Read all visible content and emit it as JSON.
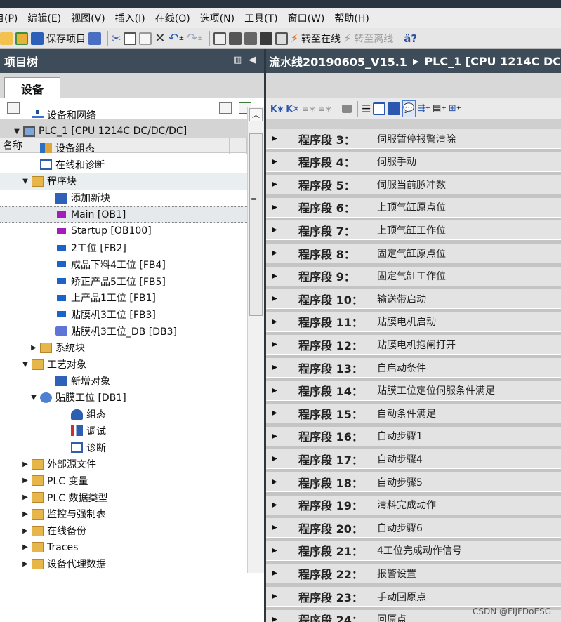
{
  "menu": [
    "目(P)",
    "编辑(E)",
    "视图(V)",
    "插入(I)",
    "在线(O)",
    "选项(N)",
    "工具(T)",
    "窗口(W)",
    "帮助(H)"
  ],
  "toolbar": {
    "save_label": "保存项目",
    "go_online_label": "转至在线",
    "go_offline_label": "转至离线"
  },
  "left_panel": {
    "title": "项目树",
    "tab_label": "设备",
    "column_name": "名称"
  },
  "tree": [
    {
      "label": "设备和网络",
      "level": 2,
      "toggle": "",
      "icon": "network-icon"
    },
    {
      "label": "PLC_1 [CPU 1214C DC/DC/DC]",
      "level": 1,
      "toggle": "▼",
      "icon": "plc-icon"
    },
    {
      "label": "设备组态",
      "level": 3,
      "toggle": "",
      "icon": "device-config-icon"
    },
    {
      "label": "在线和诊断",
      "level": 3,
      "toggle": "",
      "icon": "diagnostics-icon"
    },
    {
      "label": "程序块",
      "level": 2,
      "toggle": "▼",
      "icon": "folder-icon"
    },
    {
      "label": "添加新块",
      "level": 4,
      "toggle": "",
      "icon": "add-block-icon"
    },
    {
      "label": "Main [OB1]",
      "level": 4,
      "toggle": "",
      "icon": "ob-block-icon"
    },
    {
      "label": "Startup [OB100]",
      "level": 4,
      "toggle": "",
      "icon": "ob-block-icon"
    },
    {
      "label": "2工位 [FB2]",
      "level": 4,
      "toggle": "",
      "icon": "fb-block-icon"
    },
    {
      "label": "成品下料4工位 [FB4]",
      "level": 4,
      "toggle": "",
      "icon": "fb-block-icon"
    },
    {
      "label": "矫正产品5工位 [FB5]",
      "level": 4,
      "toggle": "",
      "icon": "fb-block-icon"
    },
    {
      "label": "上产品1工位 [FB1]",
      "level": 4,
      "toggle": "",
      "icon": "fb-block-icon"
    },
    {
      "label": "贴膜机3工位 [FB3]",
      "level": 4,
      "toggle": "",
      "icon": "fb-block-icon"
    },
    {
      "label": "贴膜机3工位_DB [DB3]",
      "level": 4,
      "toggle": "",
      "icon": "db-block-icon"
    },
    {
      "label": "系统块",
      "level": 3,
      "toggle": "▶",
      "icon": "folder-icon"
    },
    {
      "label": "工艺对象",
      "level": 2,
      "toggle": "▼",
      "icon": "folder-icon"
    },
    {
      "label": "新增对象",
      "level": 4,
      "toggle": "",
      "icon": "add-block-icon"
    },
    {
      "label": "贴膜工位 [DB1]",
      "level": 3,
      "toggle": "▼",
      "icon": "tech-object-icon"
    },
    {
      "label": "组态",
      "level": 5,
      "toggle": "",
      "icon": "config-icon"
    },
    {
      "label": "调试",
      "level": 5,
      "toggle": "",
      "icon": "commissioning-icon"
    },
    {
      "label": "诊断",
      "level": 5,
      "toggle": "",
      "icon": "diagnostics-icon"
    },
    {
      "label": "外部源文件",
      "level": 2,
      "toggle": "▶",
      "icon": "folder-icon"
    },
    {
      "label": "PLC 变量",
      "level": 2,
      "toggle": "▶",
      "icon": "folder-icon"
    },
    {
      "label": "PLC 数据类型",
      "level": 2,
      "toggle": "▶",
      "icon": "folder-icon"
    },
    {
      "label": "监控与强制表",
      "level": 2,
      "toggle": "▶",
      "icon": "folder-icon"
    },
    {
      "label": "在线备份",
      "level": 2,
      "toggle": "▶",
      "icon": "folder-icon"
    },
    {
      "label": "Traces",
      "level": 2,
      "toggle": "▶",
      "icon": "folder-icon"
    },
    {
      "label": "设备代理数据",
      "level": 2,
      "toggle": "▶",
      "icon": "folder-icon"
    }
  ],
  "editor": {
    "breadcrumb_project": "流水线20190605_V15.1",
    "breadcrumb_plc": "PLC_1 [CPU 1214C DC/DC",
    "networks": [
      {
        "label": "程序段 3：",
        "title": "伺服暂停报警清除"
      },
      {
        "label": "程序段 4：",
        "title": "伺服手动"
      },
      {
        "label": "程序段 5：",
        "title": "伺服当前脉冲数"
      },
      {
        "label": "程序段 6：",
        "title": "上顶气缸原点位"
      },
      {
        "label": "程序段 7：",
        "title": "上顶气缸工作位"
      },
      {
        "label": "程序段 8：",
        "title": "固定气缸原点位"
      },
      {
        "label": "程序段 9：",
        "title": "固定气缸工作位"
      },
      {
        "label": "程序段 10：",
        "title": "输送带启动"
      },
      {
        "label": "程序段 11：",
        "title": "贴膜电机启动"
      },
      {
        "label": "程序段 12：",
        "title": "贴膜电机抱闸打开"
      },
      {
        "label": "程序段 13：",
        "title": "自启动条件"
      },
      {
        "label": "程序段 14：",
        "title": "贴膜工位定位伺服条件满足"
      },
      {
        "label": "程序段 15：",
        "title": "自动条件满足"
      },
      {
        "label": "程序段 16：",
        "title": "自动步骤1"
      },
      {
        "label": "程序段 17：",
        "title": "自动步骤4"
      },
      {
        "label": "程序段 18：",
        "title": "自动步骤5"
      },
      {
        "label": "程序段 19：",
        "title": "清料完成动作"
      },
      {
        "label": "程序段 20：",
        "title": "自动步骤6"
      },
      {
        "label": "程序段 21：",
        "title": "4工位完成动作信号"
      },
      {
        "label": "程序段 22：",
        "title": "报警设置"
      },
      {
        "label": "程序段 23：",
        "title": "手动回原点"
      },
      {
        "label": "程序段 24：",
        "title": "回原点"
      }
    ]
  },
  "watermark": "CSDN @FIJFDoESG"
}
